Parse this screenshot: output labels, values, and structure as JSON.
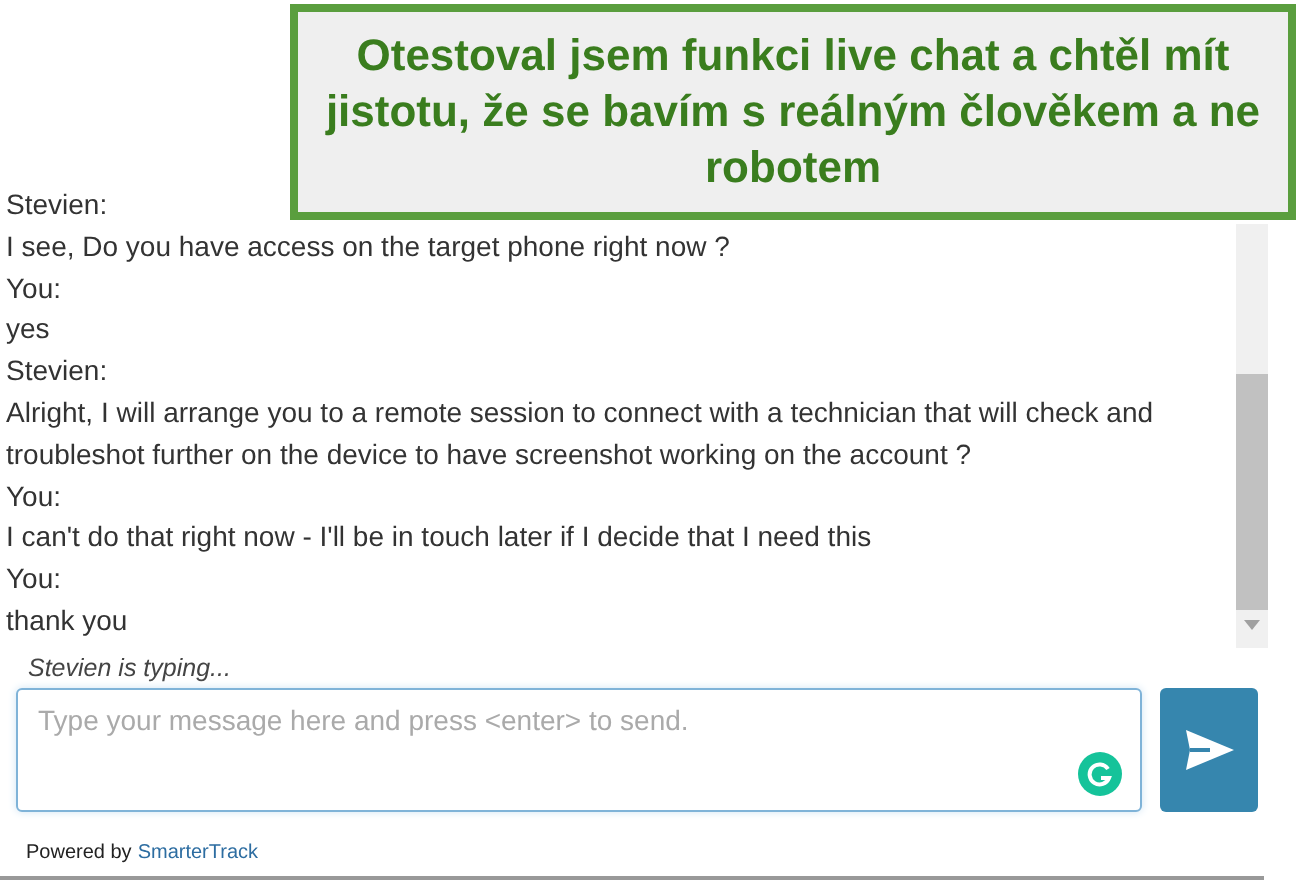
{
  "callout": {
    "text": "Otestoval jsem funkci live chat a chtěl mít jistotu, že se bavím s reálným člověkem a ne robotem"
  },
  "messages": [
    {
      "sender": "Stevien:",
      "text": "I see, Do you have access on the target phone right now ?"
    },
    {
      "sender": "You:",
      "text": "yes"
    },
    {
      "sender": "Stevien:",
      "text": "Alright, I will arrange you to a remote session to connect with a technician that will check and troubleshot further on the device to have screenshot working on the account ?"
    },
    {
      "sender": "You:",
      "text": "I can't do that right now - I'll be in touch later if I decide that I need this"
    },
    {
      "sender": "You:",
      "text": "thank you"
    }
  ],
  "typing": "Stevien is typing...",
  "composer": {
    "placeholder": "Type your message here and press <enter> to send."
  },
  "footer": {
    "prefix": "Powered by",
    "link": "SmarterTrack"
  }
}
